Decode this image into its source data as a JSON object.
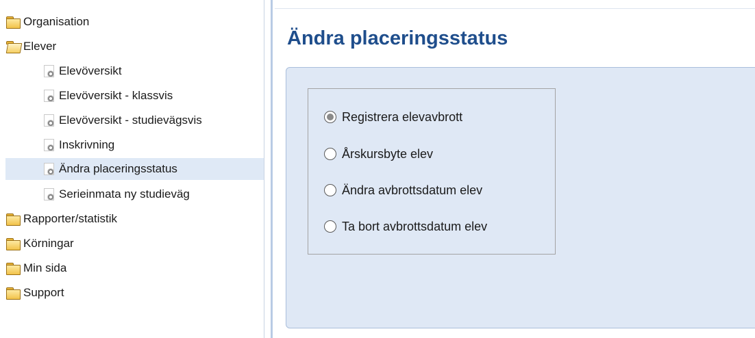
{
  "nav": {
    "items": [
      {
        "label": "Organisation",
        "icon": "folder-icon"
      },
      {
        "label": "Elever",
        "icon": "folder-open-icon"
      },
      {
        "label": "Elevöversikt",
        "icon": "page-gear-icon"
      },
      {
        "label": "Elevöversikt - klassvis",
        "icon": "page-gear-icon"
      },
      {
        "label": "Elevöversikt - studievägsvis",
        "icon": "page-gear-icon"
      },
      {
        "label": "Inskrivning",
        "icon": "page-gear-icon"
      },
      {
        "label": "Ändra placeringsstatus",
        "icon": "page-gear-icon",
        "selected": true
      },
      {
        "label": "Serieinmata ny studieväg",
        "icon": "page-gear-icon"
      },
      {
        "label": "Rapporter/statistik",
        "icon": "folder-icon"
      },
      {
        "label": "Körningar",
        "icon": "folder-icon"
      },
      {
        "label": "Min sida",
        "icon": "folder-icon"
      },
      {
        "label": "Support",
        "icon": "folder-icon"
      }
    ]
  },
  "main": {
    "title": "Ändra placeringsstatus",
    "options": [
      {
        "label": "Registrera elevavbrott",
        "checked": true
      },
      {
        "label": "Årskursbyte elev",
        "checked": false
      },
      {
        "label": "Ändra avbrottsdatum elev",
        "checked": false
      },
      {
        "label": "Ta bort avbrottsdatum elev",
        "checked": false
      }
    ]
  },
  "colors": {
    "title": "#1f4e8c",
    "panel_bg": "#dfe8f5",
    "selected_row": "#dfe9f6"
  }
}
